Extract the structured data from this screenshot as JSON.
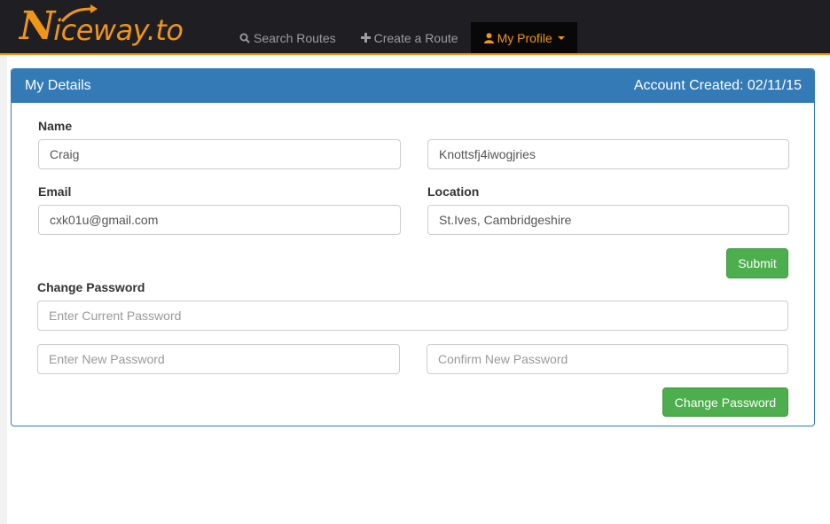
{
  "brand": {
    "first_letter": "N",
    "rest": "iceway.to",
    "color": "#f0951a"
  },
  "nav": {
    "items": [
      {
        "label": "Search Routes",
        "icon": "search-icon"
      },
      {
        "label": "Create a Route",
        "icon": "plus-icon"
      },
      {
        "label": "My Profile",
        "icon": "user-icon",
        "active": true
      }
    ]
  },
  "panel": {
    "title": "My Details",
    "account_created": "Account Created: 02/11/15",
    "accent": "#337ab7"
  },
  "form": {
    "name_label": "Name",
    "first_name": "Craig",
    "last_name": "Knottsfj4iwogjries",
    "email_label": "Email",
    "email": "cxk01u@gmail.com",
    "location_label": "Location",
    "location": "St.Ives, Cambridgeshire",
    "submit_label": "Submit"
  },
  "password": {
    "heading": "Change Password",
    "current_placeholder": "Enter Current Password",
    "new_placeholder": "Enter New Password",
    "confirm_placeholder": "Confirm New Password",
    "button_label": "Change Password"
  },
  "colors": {
    "navbar": "#1e1e23",
    "button_green": "#4cae4c"
  }
}
